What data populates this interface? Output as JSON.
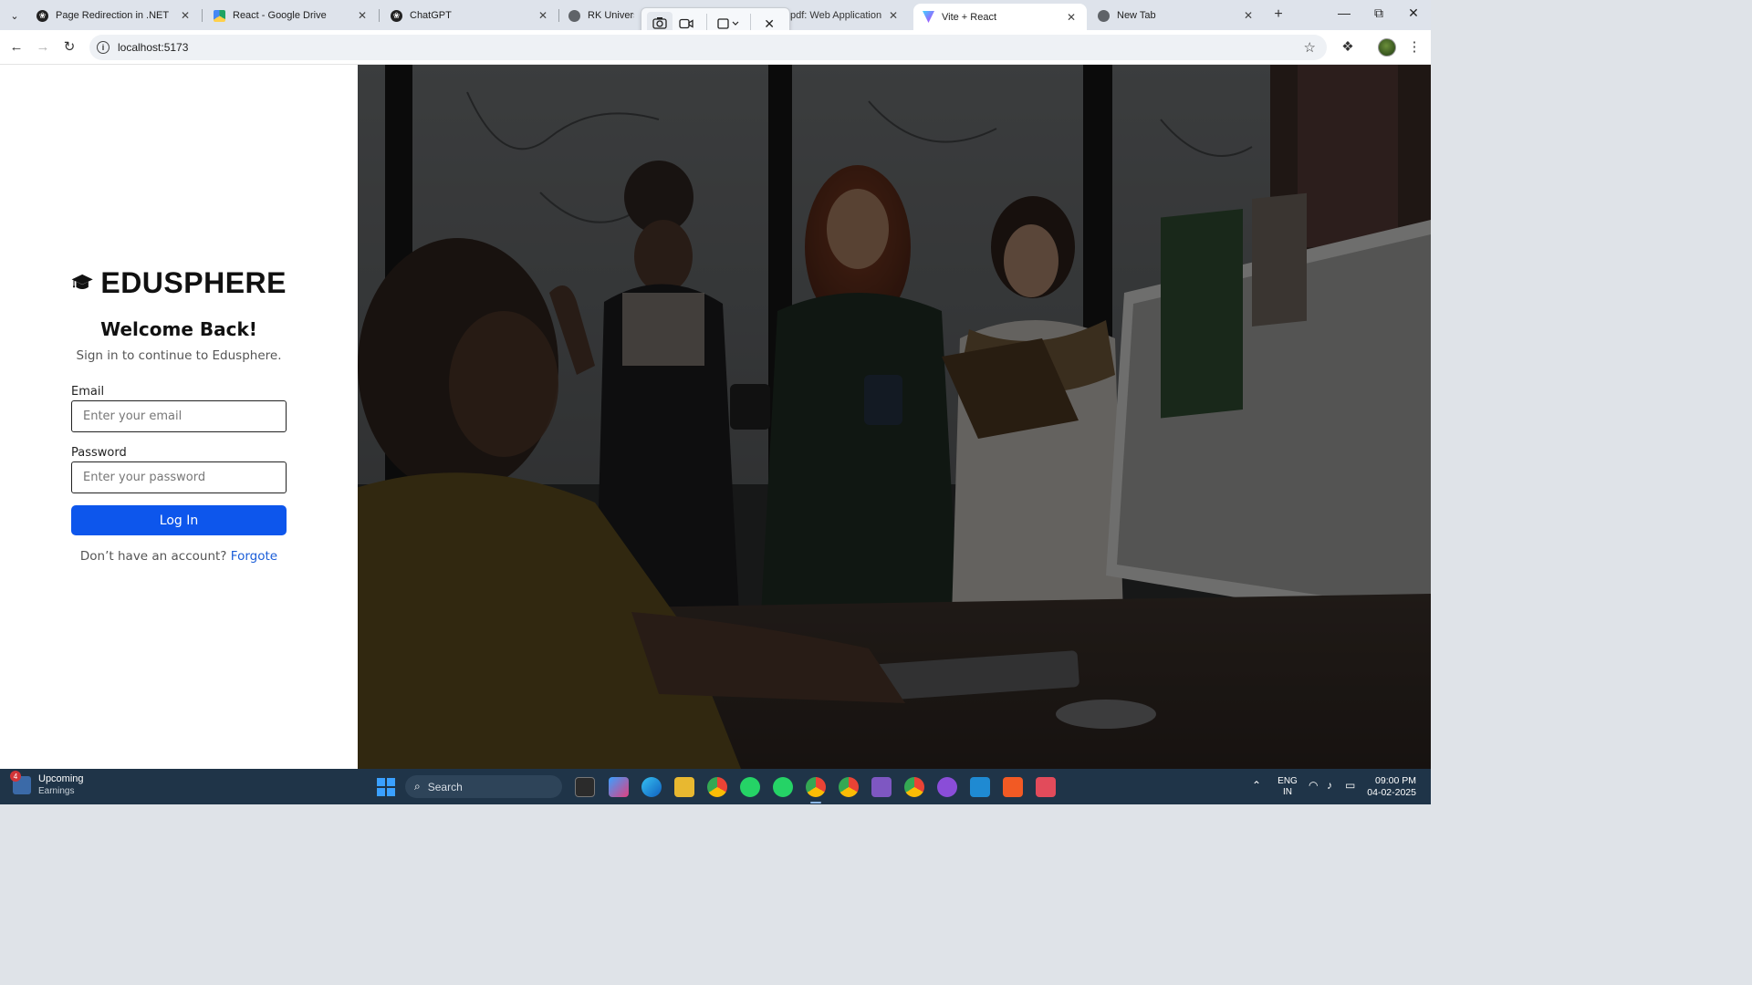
{
  "browser": {
    "tabs": [
      {
        "title": "Page Redirection in .NET",
        "favicon": "chatgpt-icon",
        "active": false
      },
      {
        "title": "React - Google Drive",
        "favicon": "google-drive-icon",
        "active": false
      },
      {
        "title": "ChatGPT",
        "favicon": "chatgpt-icon",
        "active": false
      },
      {
        "title": "RK University",
        "favicon": "globe-icon",
        "active": false
      },
      {
        "title": "pdf: Web Application D",
        "favicon": "",
        "active": false
      },
      {
        "title": "Vite + React",
        "favicon": "vite-icon",
        "active": true
      },
      {
        "title": "New Tab",
        "favicon": "chrome-icon",
        "active": false
      }
    ],
    "url": "localhost:5173"
  },
  "page": {
    "brand_name": "EDUSPHERE",
    "welcome_title": "Welcome Back!",
    "welcome_subtitle": "Sign in to continue to Edusphere.",
    "email_label": "Email",
    "email_placeholder": "Enter your email",
    "email_value": "",
    "password_label": "Password",
    "password_placeholder": "Enter your password",
    "password_value": "",
    "login_button": "Log In",
    "signup_prompt": "Don’t have an account?",
    "signup_link": "Forgote",
    "accent_color": "#0d56ec"
  },
  "taskbar": {
    "widget_badge": "4",
    "widget_title": "Upcoming",
    "widget_subtitle": "Earnings",
    "search_placeholder": "Search",
    "language_top": "ENG",
    "language_bottom": "IN",
    "time": "09:00 PM",
    "date": "04-02-2025"
  }
}
